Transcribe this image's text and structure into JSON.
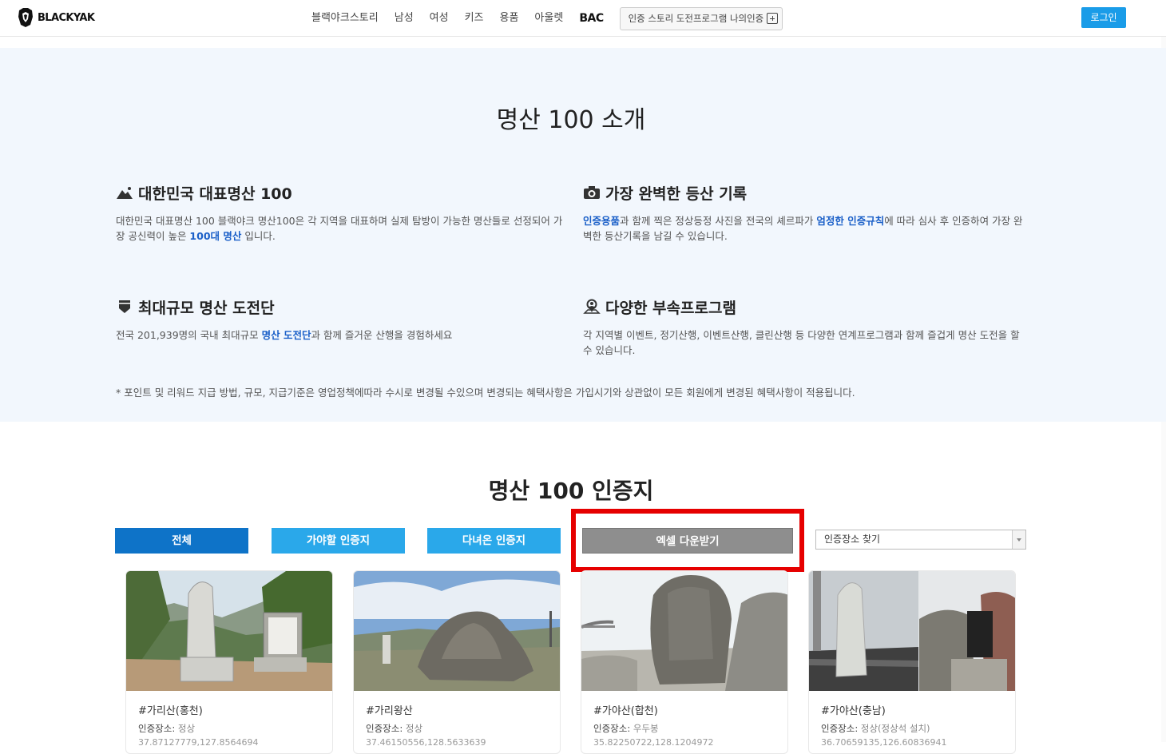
{
  "header": {
    "logo_text": "BLACKYAK",
    "nav": [
      "블랙야크스토리",
      "남성",
      "여성",
      "키즈",
      "용품",
      "아울렛"
    ],
    "nav_bac": "BAC",
    "nav_box_label": "인증 스토리 도전프로그램 나의인증",
    "login": "로그인"
  },
  "intro": {
    "title": "명산 100 소개",
    "features": [
      {
        "icon": "mountain-icon",
        "title": "대한민국 대표명산 100",
        "text_a": "대한민국 대표명산 100 블랙야크 명산100은 각 지역을 대표하며 실제 탐방이 가능한 명산들로 선정되어 가장 공신력이 높은 ",
        "bold": "100대 명산",
        "text_b": " 입니다."
      },
      {
        "icon": "camera-icon",
        "title": "가장 완벽한 등산 기록",
        "bold_a": "인증용품",
        "text_a": "과 함께 찍은 정상등정 사진을 전국의 셰르파가 ",
        "bold_b": "엄정한 인증규칙",
        "text_b": "에 따라 심사 후 인증하여 가장 완벽한 등산기록을 남길 수 있습니다."
      },
      {
        "icon": "shield-icon",
        "title": "최대규모 명산 도전단",
        "text_a": "전국 201,939명의 국내 최대규모 ",
        "bold": "명산 도전단",
        "text_b": "과 함께 즐거운 산행을 경험하세요"
      },
      {
        "icon": "location-person-icon",
        "title": "다양한 부속프로그램",
        "text_a": "각 지역별 이벤트, 정기산행, 이벤트산행, 클린산행 등 다양한 연계프로그램과 함께 즐겁게 명산 도전을 할 수 있습니다."
      }
    ],
    "disclaimer": "* 포인트 및 리워드 지급 방법, 규모, 지급기준은 영업정책에따라 수시로 변경될 수있으며 변경되는 혜택사항은 가입시기와 상관없이 모든 회원에게 변경된 혜택사항이 적용됩니다."
  },
  "cert": {
    "title": "명산 100 인증지",
    "btn_all": "전체",
    "btn_togo": "가야할 인증지",
    "btn_visited": "다녀온 인증지",
    "btn_excel": "엑셀 다운받기",
    "select_value": "인증장소 찾기",
    "loc_key": "인증장소:",
    "cards": [
      {
        "name": "#가리산(홍천)",
        "loc": "정상",
        "coord": "37.87127779,127.8564694"
      },
      {
        "name": "#가리왕산",
        "loc": "정상",
        "coord": "37.46150556,128.5633639"
      },
      {
        "name": "#가야산(합천)",
        "loc": "우두봉",
        "coord": "35.82250722,128.1204972"
      },
      {
        "name": "#가야산(충남)",
        "loc": "정상(정상석 설치)",
        "coord": "36.70659135,126.60836941"
      }
    ]
  },
  "colors": {
    "primary": "#0e73c8",
    "secondary": "#2aa8ea",
    "excel": "#8e8e8e",
    "highlight": "#e60000",
    "login": "#1a9ce8"
  }
}
